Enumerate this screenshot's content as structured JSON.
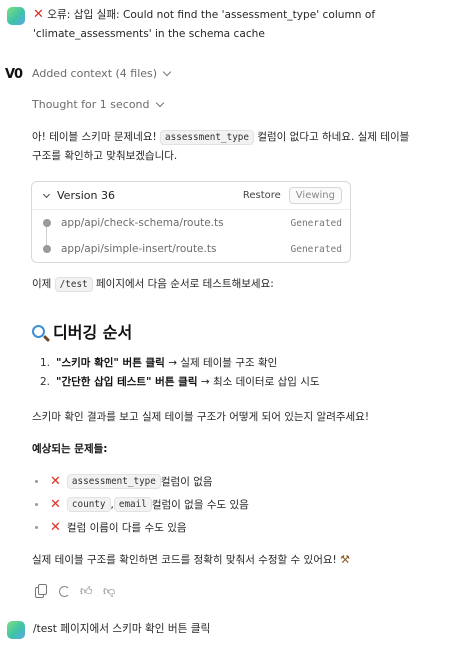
{
  "colors": {
    "error": "#d93025",
    "accent": "#3fc2a8"
  },
  "user_message_1": {
    "error_prefix": "오류: 삽입 실패: Could not find the 'assessment_type' column of",
    "error_line2": "'climate_assessments' in the schema cache",
    "icon": "cross-mark-icon"
  },
  "assistant": {
    "logo": "V0",
    "added_context": "Added context (4 files)",
    "thought": "Thought for 1 second",
    "intro_p1_a": "아! 테이블 스키마 문제네요! ",
    "intro_code": "assessment_type",
    "intro_p1_b": " 컬럼이 없다고 하네요. 실제 테이블",
    "intro_p2": "구조를 확인하고 맞춰보겠습니다.",
    "version_card": {
      "title": "Version 36",
      "restore": "Restore",
      "viewing": "Viewing",
      "files": [
        {
          "path": "app/api/check-schema/route.ts",
          "status": "Generated"
        },
        {
          "path": "app/api/simple-insert/route.ts",
          "status": "Generated"
        }
      ]
    },
    "test_p_a": "이제 ",
    "test_code": "/test",
    "test_p_b": " 페이지에서 다음 순서로 테스트해보세요:",
    "heading": "디버깅 순서",
    "steps": [
      {
        "num": "1.",
        "bold": "\"스키마 확인\" 버튼 클릭",
        "rest": " → 실제 테이블 구조 확인"
      },
      {
        "num": "2.",
        "bold": "\"간단한 삽입 테스트\" 버튼 클릭",
        "rest": " → 최소 데이터로 삽입 시도"
      }
    ],
    "result_p": "스키마 확인 결과를 보고 실제 테이블 구조가 어떻게 되어 있는지 알려주세요!",
    "expected_title": "예상되는 문제들:",
    "issues": [
      {
        "code1": "assessment_type",
        "text": " 컬럼이 없음"
      },
      {
        "code1": "county",
        "sep": ", ",
        "code2": "email",
        "text": " 컬럼이 없을 수도 있음"
      },
      {
        "text": "컬럼 이름이 다를 수도 있음"
      }
    ],
    "closing": "실제 테이블 구조를 확인하면 코드를 정확히 맞춰서 수정할 수 있어요! ",
    "closing_icon": "tools-icon"
  },
  "user_message_2": {
    "text": "/test 페이지에서 스키마 확인 버튼 클릭"
  }
}
